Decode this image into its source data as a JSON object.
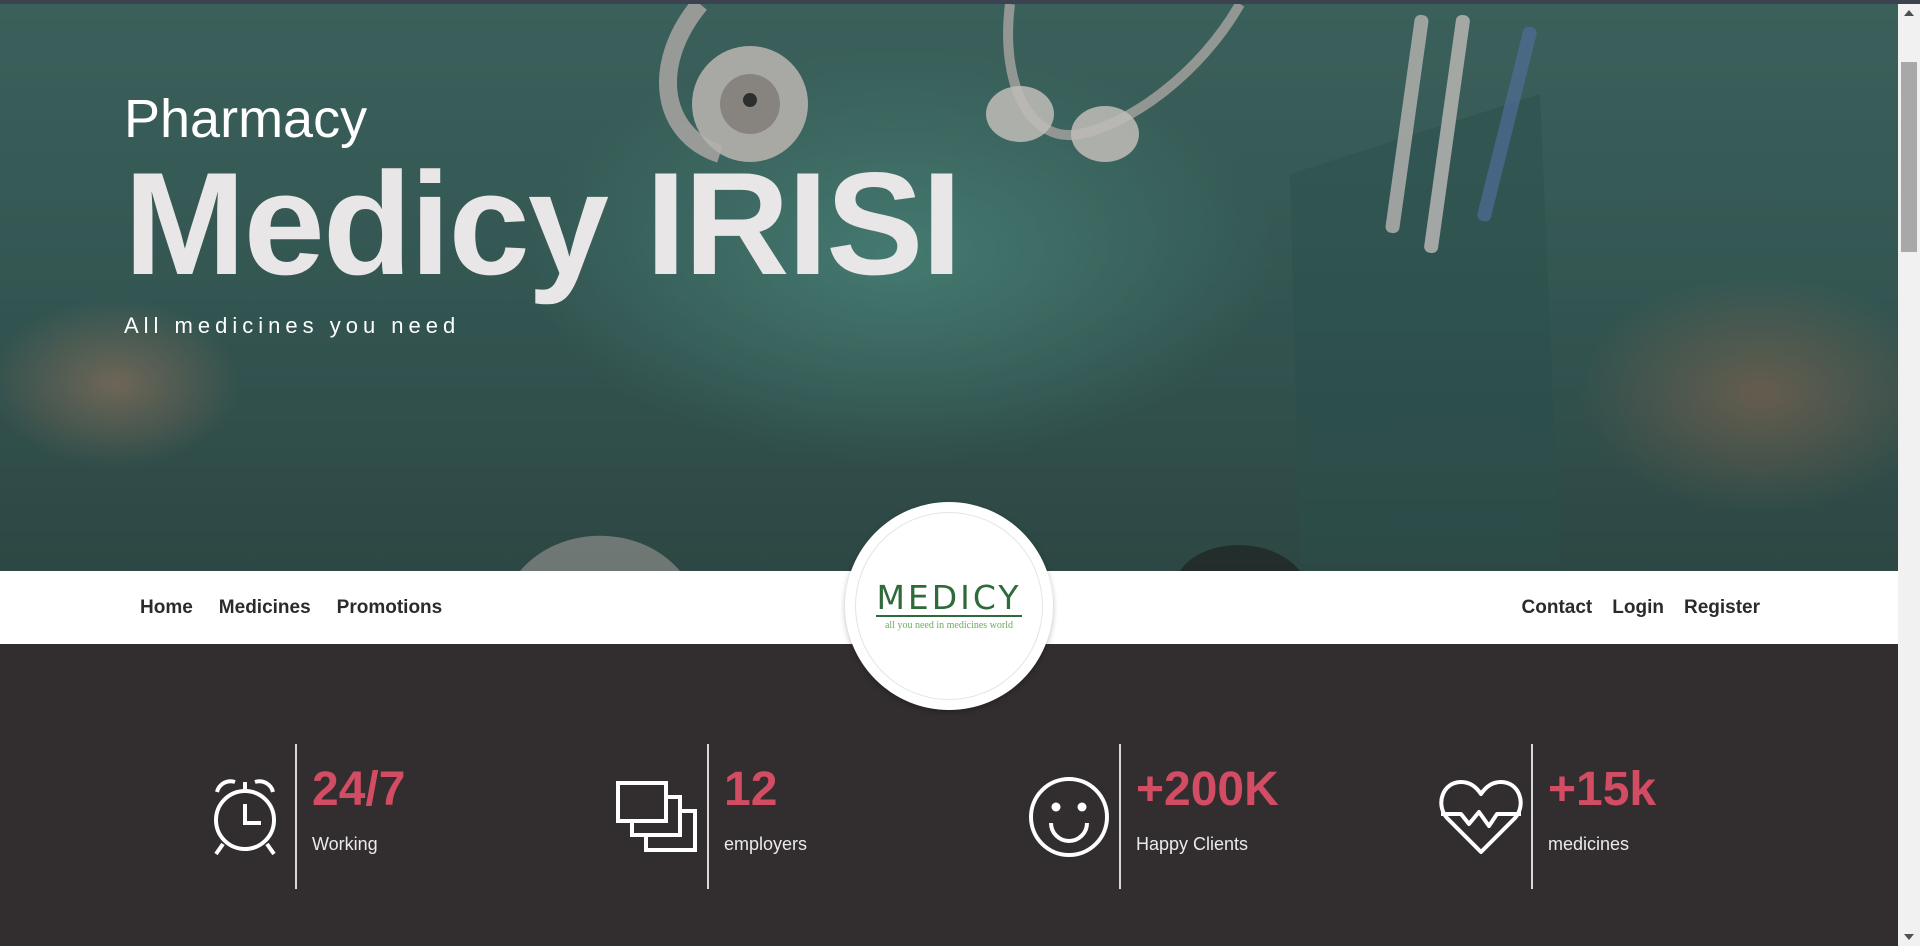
{
  "hero": {
    "subtitle": "Pharmacy",
    "title": "Medicy IRISI",
    "tagline": "All medicines you need"
  },
  "nav": {
    "left": [
      "Home",
      "Medicines",
      "Promotions"
    ],
    "right": [
      "Contact",
      "Login",
      "Register"
    ]
  },
  "logo": {
    "wordmark": "MEDICY",
    "tagline": "all you need in medicines world"
  },
  "stats": [
    {
      "icon": "alarm-clock-icon",
      "value": "24/7",
      "label": "Working"
    },
    {
      "icon": "stacked-squares-icon",
      "value": "12",
      "label": "employers"
    },
    {
      "icon": "smiley-face-icon",
      "value": "+200K",
      "label": "Happy Clients"
    },
    {
      "icon": "heartbeat-icon",
      "value": "+15k",
      "label": "medicines"
    }
  ],
  "colors": {
    "accent": "#d24c63",
    "dark_bg": "#322d2e",
    "logo_green": "#2f6b3a"
  }
}
